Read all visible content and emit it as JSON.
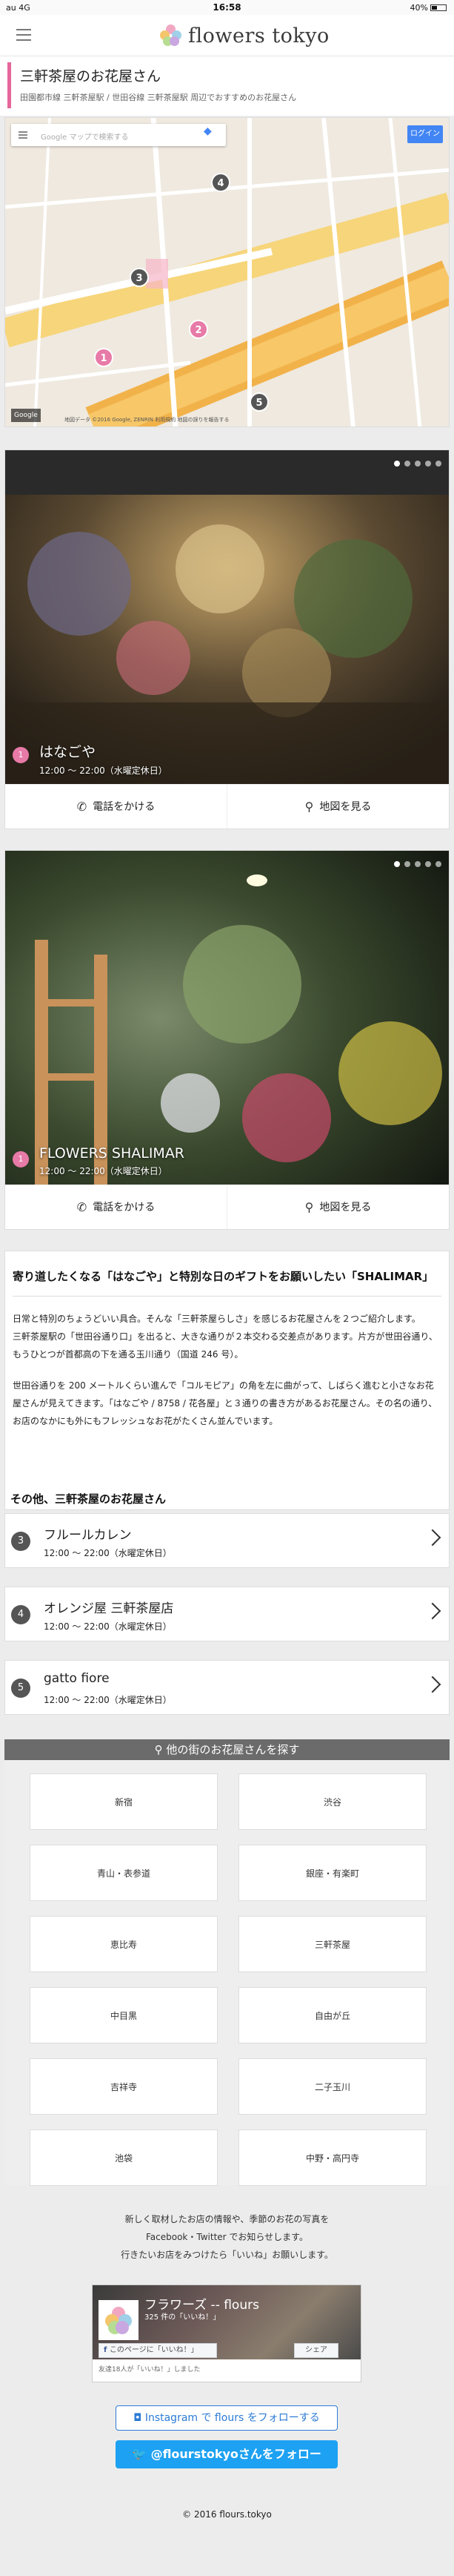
{
  "status_bar": {
    "carrier": "au 4G",
    "time": "16:58",
    "battery": "40%"
  },
  "header": {
    "logo_text": "flowers tokyo"
  },
  "page": {
    "title": "三軒茶屋のお花屋さん",
    "subtitle": "田園都市線 三軒茶屋駅 / 世田谷線 三軒茶屋駅 周辺でおすすめのお花屋さん"
  },
  "map": {
    "search_placeholder": "Google マップで検索する",
    "login_label": "ログイン",
    "brand": "Google",
    "footer": "地図データ ©2016 Google, ZENRIN  利用規約  地図の誤りを報告する",
    "markers": [
      "1",
      "2",
      "3",
      "4",
      "5"
    ]
  },
  "shops": [
    {
      "number": "1",
      "name": "はなごや",
      "hours": "12:00 〜 22:00（水曜定休日）",
      "call_label": "電話をかける",
      "map_label": "地図を見る"
    },
    {
      "number": "1",
      "name": "FLOWERS SHALIMAR",
      "hours": "12:00 〜 22:00（水曜定休日）",
      "call_label": "電話をかける",
      "map_label": "地図を見る"
    }
  ],
  "article": {
    "heading": "寄り道したくなる「はなごや」と特別な日のギフトをお願いしたい「SHALIMAR」",
    "p1": "日常と特別のちょうどいい具合。そんな「三軒茶屋らしさ」を感じるお花屋さんを２つご紹介します。",
    "p2": "三軒茶屋駅の「世田谷通り口」を出ると、大きな通りが２本交わる交差点があります。片方が世田谷通り、もうひとつが首都高の下を通る玉川通り（国道 246 号）。",
    "p3": "世田谷通りを 200 メートルくらい進んで「コルモピア」の角を左に曲がって、しばらく進むと小さなお花屋さんが見えてきます。「はなごや / 8758 / 花各屋」と３通りの書き方があるお花屋さん。その名の通り、お店のなかにも外にもフレッシュなお花がたくさん並んでいます。"
  },
  "others": {
    "label": "その他、三軒茶屋のお花屋さん",
    "items": [
      {
        "number": "3",
        "name": "フルールカレン",
        "hours": "12:00 〜 22:00（水曜定休日）"
      },
      {
        "number": "4",
        "name": "オレンジ屋 三軒茶屋店",
        "hours": "12:00 〜 22:00（水曜定休日）"
      },
      {
        "number": "5",
        "name": "gatto fiore",
        "hours": "12:00 〜 22:00（水曜定休日）"
      }
    ]
  },
  "towns": {
    "heading": "他の街のお花屋さんを探す",
    "items": [
      "新宿",
      "渋谷",
      "青山・表参道",
      "銀座・有楽町",
      "恵比寿",
      "三軒茶屋",
      "中目黒",
      "自由が丘",
      "吉祥寺",
      "二子玉川",
      "池袋",
      "中野・高円寺"
    ]
  },
  "footer": {
    "notice_1": "新しく取材したお店の情報や、季節のお花の写真を",
    "notice_2": "Facebook・Twitter でお知らせします。",
    "notice_3": "行きたいお店をみつけたら「いいね」お願いします。",
    "fb_name": "フラワーズ -- flours",
    "fb_likes": "325 件の「いいね！」",
    "fb_like_label": "このページに「いいね！」",
    "fb_share_label": "シェア",
    "fb_friends": "友達18人が「いいね！」しました",
    "instagram_label": "Instagram で flours をフォローする",
    "twitter_label": "@flourstokyoさんをフォロー",
    "copyright": "© 2016 flours.tokyo"
  },
  "colors": {
    "accent": "#e77aa7",
    "twitter": "#1da1f2",
    "instagram": "#2c7bd6"
  }
}
